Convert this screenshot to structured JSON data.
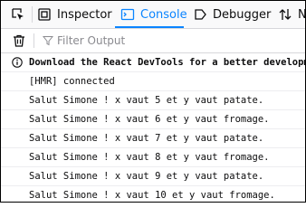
{
  "toolbar": {
    "tabs": [
      {
        "label": "Inspector"
      },
      {
        "label": "Console"
      },
      {
        "label": "Debugger"
      },
      {
        "label": "Ne"
      }
    ]
  },
  "filter": {
    "placeholder": "Filter Output"
  },
  "console": {
    "messages": [
      {
        "text": "Download the React DevTools for a better developmen"
      },
      {
        "text": "[HMR] connected"
      },
      {
        "text": "Salut Simone ! x vaut 5 et y vaut patate."
      },
      {
        "text": "Salut Simone ! x vaut 6 et y vaut fromage."
      },
      {
        "text": "Salut Simone ! x vaut 7 et y vaut patate."
      },
      {
        "text": "Salut Simone ! x vaut 8 et y vaut fromage."
      },
      {
        "text": "Salut Simone ! x vaut 9 et y vaut patate."
      },
      {
        "text": "Salut Simone ! x vaut 10 et y vaut fromage."
      }
    ]
  },
  "colors": {
    "accent": "#0a84ff",
    "text": "#0c0c0d",
    "border": "#d7d7db"
  },
  "icons": [
    "element-picker-icon",
    "inspector-icon",
    "console-icon",
    "debugger-icon",
    "network-icon",
    "trash-icon",
    "filter-icon",
    "info-icon"
  ]
}
